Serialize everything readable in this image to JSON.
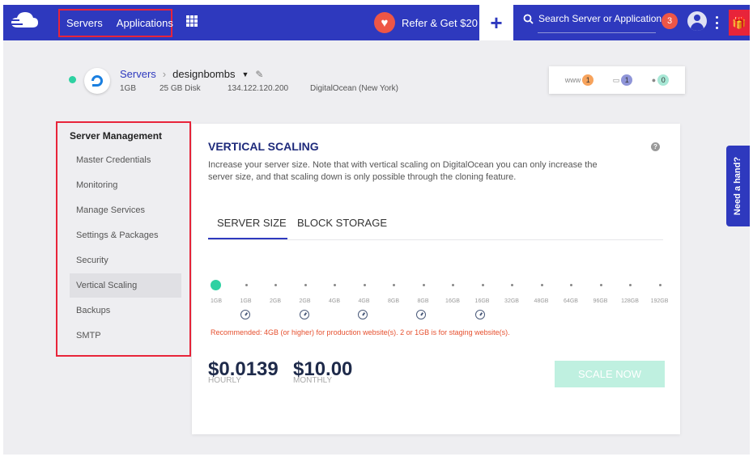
{
  "nav": {
    "servers": "Servers",
    "applications": "Applications",
    "refer": "Refer & Get $20",
    "add": "+",
    "search_placeholder": "Search Server or Application",
    "notifications": "3"
  },
  "server": {
    "breadcrumb_root": "Servers",
    "name": "designbombs",
    "ram": "1GB",
    "disk": "25 GB Disk",
    "ip": "134.122.120.200",
    "provider": "DigitalOcean (New York)"
  },
  "stats": [
    {
      "label": "www",
      "count": "1",
      "color": "#f7a35c"
    },
    {
      "label": "db",
      "count": "1",
      "color": "#8f95d8"
    },
    {
      "label": "users",
      "count": "0",
      "color": "#a8e8d6"
    }
  ],
  "sidebar": {
    "title": "Server Management",
    "items": [
      {
        "label": "Master Credentials"
      },
      {
        "label": "Monitoring"
      },
      {
        "label": "Manage Services"
      },
      {
        "label": "Settings & Packages"
      },
      {
        "label": "Security"
      },
      {
        "label": "Vertical Scaling"
      },
      {
        "label": "Backups"
      },
      {
        "label": "SMTP"
      }
    ]
  },
  "panel": {
    "title": "VERTICAL SCALING",
    "description": "Increase your server size. Note that with vertical scaling on DigitalOcean you can only increase the server size, and that scaling down is only possible through the cloning feature.",
    "tabs": [
      "SERVER SIZE",
      "BLOCK STORAGE"
    ],
    "sizes": [
      "1GB",
      "1GB",
      "2GB",
      "2GB",
      "4GB",
      "4GB",
      "8GB",
      "8GB",
      "16GB",
      "16GB",
      "32GB",
      "48GB",
      "64GB",
      "96GB",
      "128GB",
      "192GB"
    ],
    "recommendation": "Recommended: 4GB (or higher) for production website(s). 2 or 1GB is for staging website(s).",
    "hourly_price": "$0.0139",
    "hourly_label": "HOURLY",
    "monthly_price": "$10.00",
    "monthly_label": "MONTHLY",
    "scale_button": "SCALE NOW"
  },
  "help_tab": "Need a hand?"
}
